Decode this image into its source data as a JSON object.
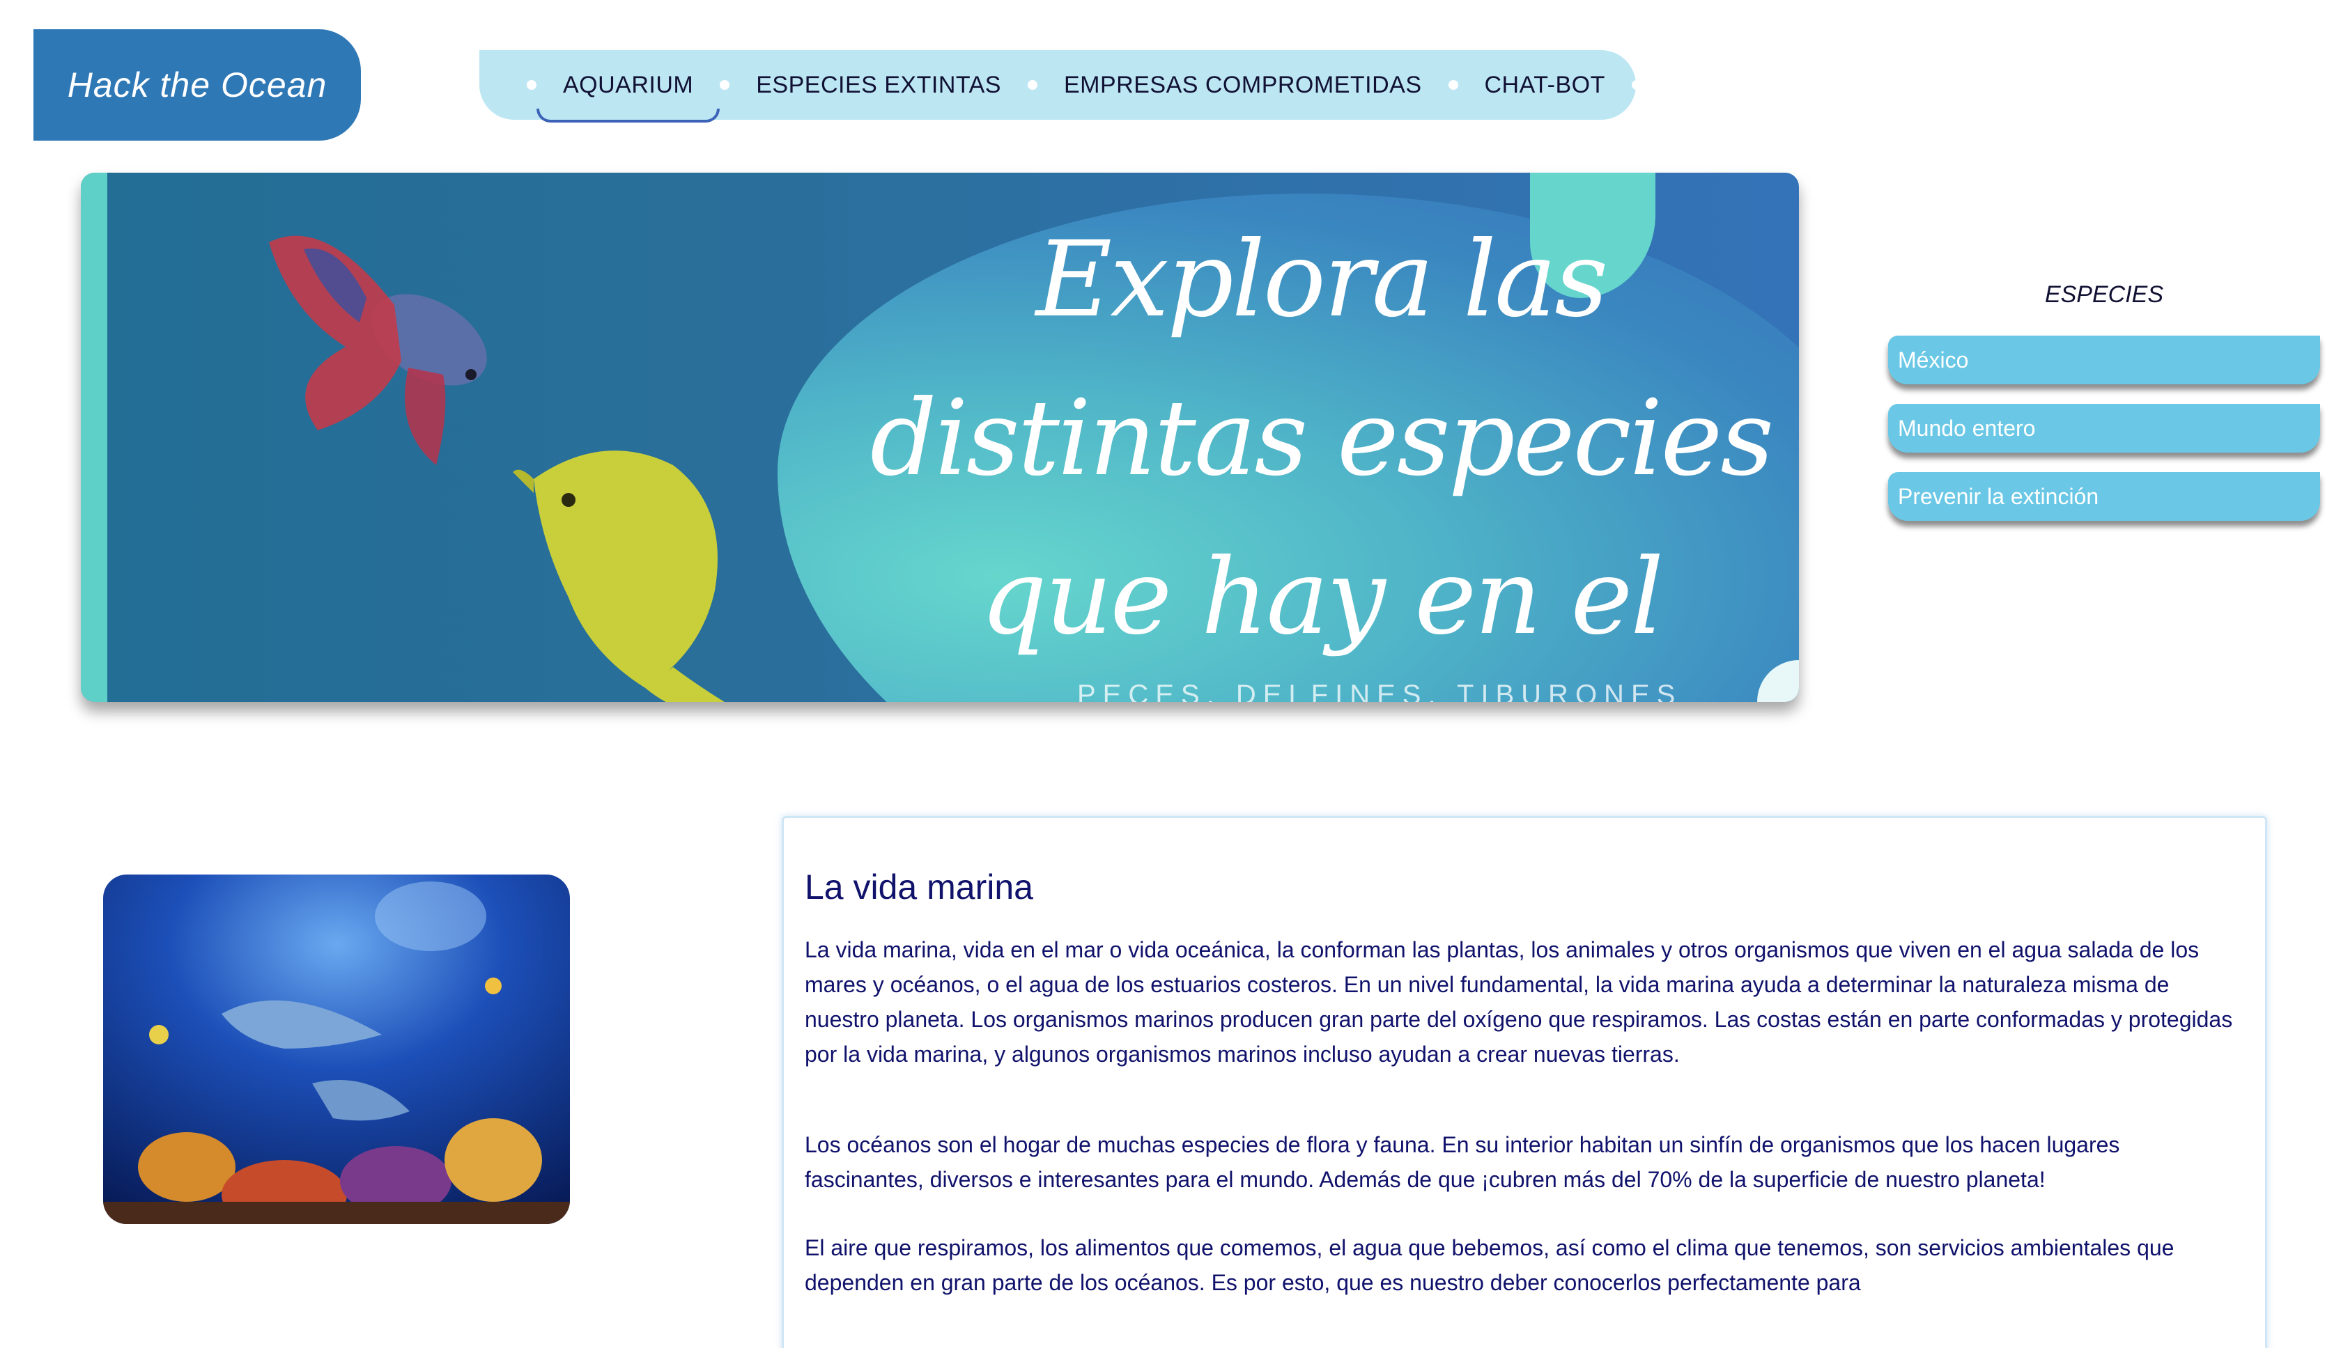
{
  "logo": {
    "text": "Hack the Ocean"
  },
  "nav": {
    "items": [
      {
        "label": "AQUARIUM",
        "active": true
      },
      {
        "label": "ESPECIES EXTINTAS",
        "active": false
      },
      {
        "label": "EMPRESAS COMPROMETIDAS",
        "active": false
      },
      {
        "label": "CHAT-BOT",
        "active": false
      }
    ]
  },
  "banner": {
    "title_lines": [
      "Explora las",
      "distintas especies",
      "que hay en el oceano"
    ],
    "subtitle": "PECES, DELFINES, TIBURONES"
  },
  "sidebar": {
    "title": "ESPECIES",
    "buttons": [
      "México",
      "Mundo entero",
      "Prevenir la extinción"
    ]
  },
  "content": {
    "heading": "La vida marina",
    "paragraphs": [
      "La vida marina, vida en el mar o vida oceánica, la conforman las plantas, los animales y otros organismos que viven en el agua salada de los mares y océanos, o el agua de los estuarios costeros. En un nivel fundamental, la vida marina ayuda a determinar la naturaleza misma de nuestro planeta. Los organismos marinos producen gran parte del oxígeno que respiramos. Las costas están en parte conformadas y protegidas por la vida marina, y algunos organismos marinos incluso ayudan a crear nuevas tierras.",
      "Los océanos son el hogar de muchas especies de flora y fauna. En su interior habitan un sinfín de organismos que los hacen lugares fascinantes, diversos e interesantes para el mundo. Además de que ¡cubren más del 70% de la superficie de nuestro planeta!",
      "El aire que respiramos, los alimentos que comemos, el agua que bebemos, así como el clima que tenemos, son servicios ambientales que dependen en gran parte de los océanos. Es por esto, que es nuestro deber conocerlos perfectamente para"
    ]
  },
  "colors": {
    "logo_bg": "#2f78b6",
    "nav_bg": "#bde6f3",
    "side_button": "#6ac8e6",
    "text_dark": "#10126b"
  }
}
